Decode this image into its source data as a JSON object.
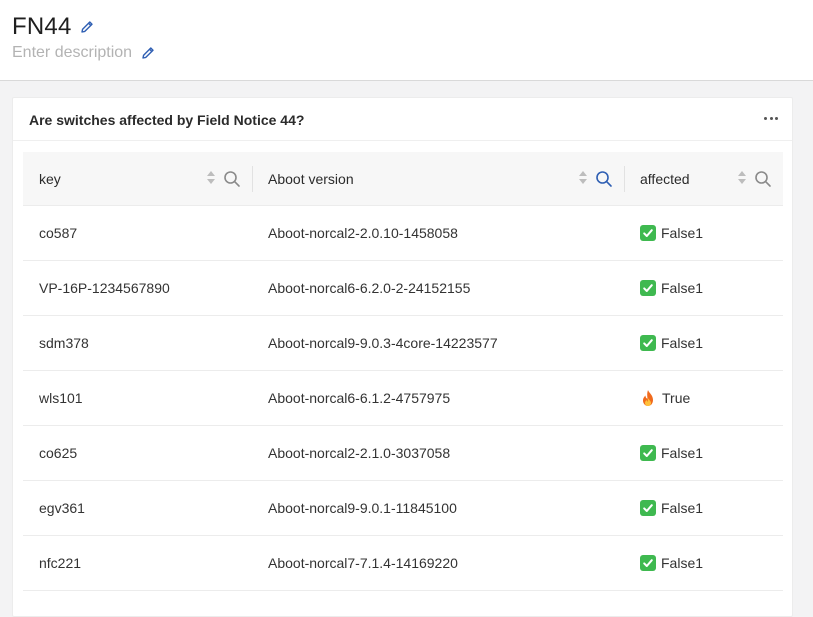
{
  "header": {
    "title": "FN44",
    "description_placeholder": "Enter description"
  },
  "card": {
    "title": "Are switches affected by Field Notice 44?"
  },
  "table": {
    "columns": [
      {
        "label": "key"
      },
      {
        "label": "Aboot version"
      },
      {
        "label": "affected"
      }
    ],
    "rows": [
      {
        "key": "co587",
        "version": "Aboot-norcal2-2.0.10-1458058",
        "affected": "False1",
        "icon": "check-icon"
      },
      {
        "key": "VP-16P-1234567890",
        "version": "Aboot-norcal6-6.2.0-2-24152155",
        "affected": "False1",
        "icon": "check-icon"
      },
      {
        "key": "sdm378",
        "version": "Aboot-norcal9-9.0.3-4core-14223577",
        "affected": "False1",
        "icon": "check-icon"
      },
      {
        "key": "wls101",
        "version": "Aboot-norcal6-6.1.2-4757975",
        "affected": "True",
        "icon": "fire-icon"
      },
      {
        "key": "co625",
        "version": "Aboot-norcal2-2.1.0-3037058",
        "affected": "False1",
        "icon": "check-icon"
      },
      {
        "key": "egv361",
        "version": "Aboot-norcal9-9.0.1-11845100",
        "affected": "False1",
        "icon": "check-icon"
      },
      {
        "key": "nfc221",
        "version": "Aboot-norcal7-7.1.4-14169220",
        "affected": "False1",
        "icon": "check-icon"
      }
    ]
  },
  "colors": {
    "accent_search_active": "#2f5fb3",
    "check_green": "#3fb950",
    "fire_orange": "#f06a1d"
  }
}
